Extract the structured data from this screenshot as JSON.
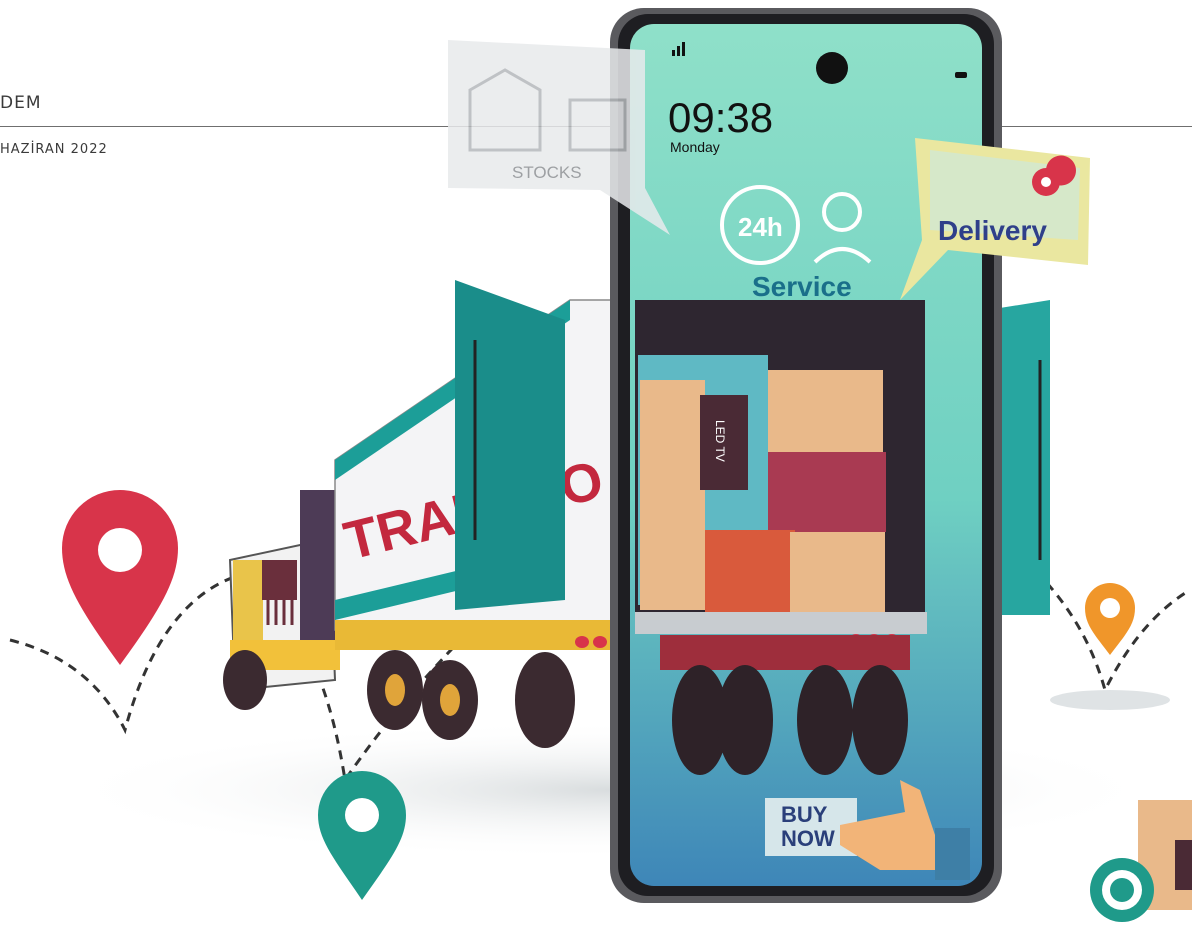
{
  "header": {
    "magazine_name": "DEM",
    "issue_date": "HAZİRAN 2022"
  },
  "illustration": {
    "stocks_label": "STOCKS",
    "phone_time": "09:38",
    "phone_day": "Monday",
    "service_hours": "24h",
    "service_label": "Service",
    "delivery_label": "Delivery",
    "truck_text": "TRANSPO",
    "box_label": "LED TV",
    "buy_now_label": [
      "BUY",
      "NOW"
    ],
    "colors": {
      "teal": "#1a9e9a",
      "red_pin": "#d8344a",
      "orange_pin": "#f0962a",
      "green_pin": "#1f9a8a",
      "phone_screen": "#7fd9c6",
      "cardboard": "#e9b98a"
    }
  }
}
